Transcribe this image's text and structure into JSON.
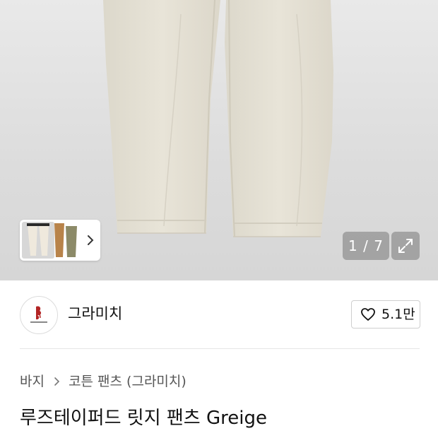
{
  "gallery": {
    "counter": "1 / 7",
    "main_image_icon": "pants-photo",
    "thumbnail_icon": "pants-thumbnails",
    "next_icon": "chevron-right-icon",
    "expand_icon": "expand-icon"
  },
  "brand": {
    "name": "그라미치",
    "logo_icon": "brand-logo",
    "like_count": "5.1만",
    "like_icon": "heart-icon"
  },
  "breadcrumb": {
    "items": [
      "바지",
      "코튼 팬츠 (그라미치)"
    ],
    "separator_icon": "chevron-right-icon"
  },
  "product": {
    "title": "루즈테이퍼드 릿지 팬츠 Greige"
  },
  "colors": {
    "hero_bg": "#dcdcdc",
    "pants": "#e5e0d3",
    "text": "#111111",
    "muted": "#555555"
  }
}
